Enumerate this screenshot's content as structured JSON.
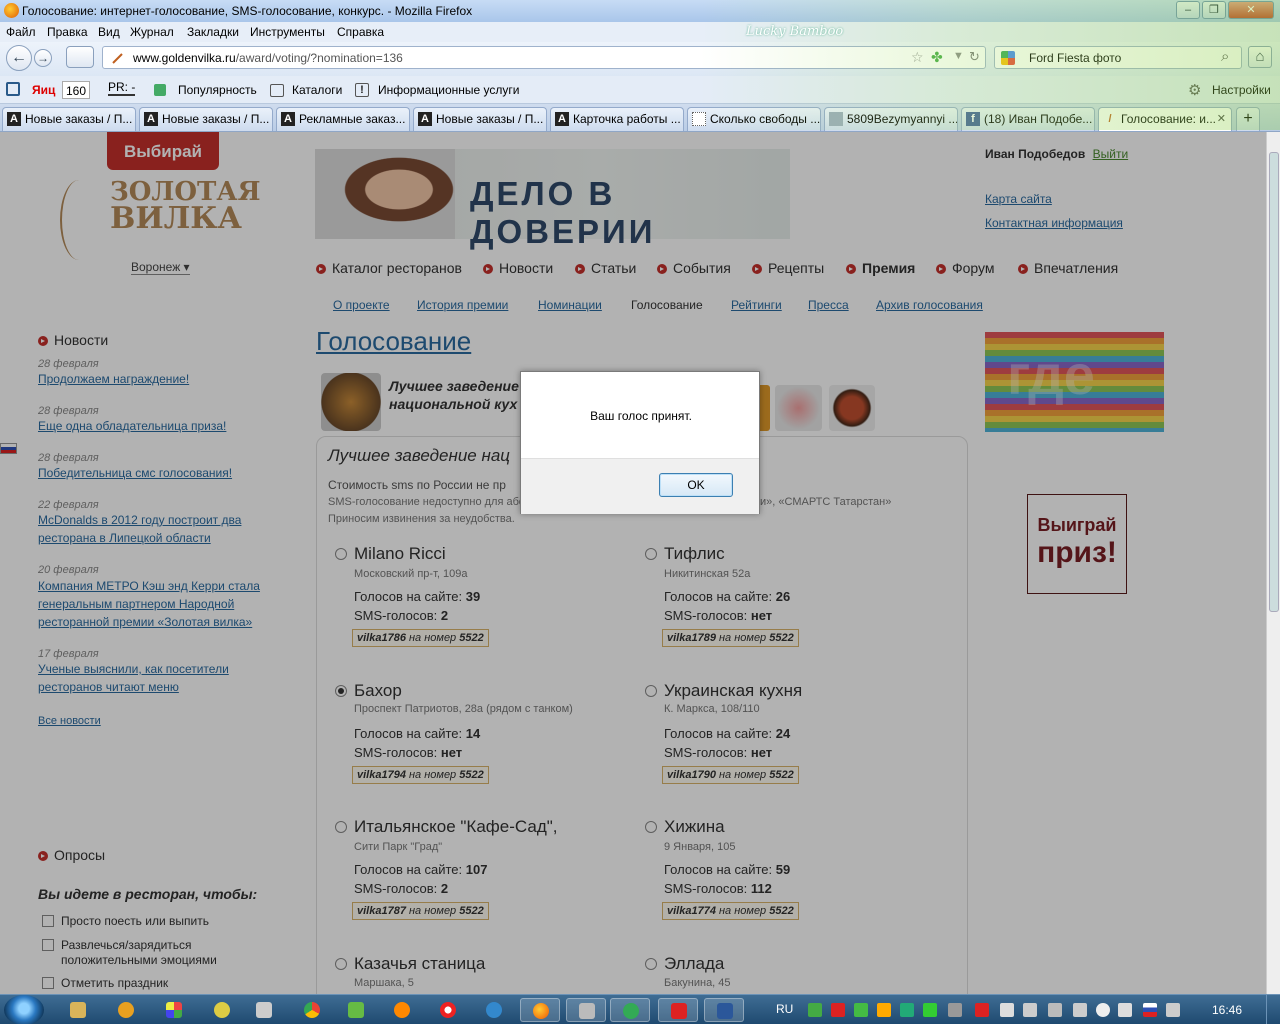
{
  "window": {
    "title": "Голосование: интернет-голосование, SMS-голосование, конкурс. - Mozilla Firefox",
    "theme_label": "Lucky Bamboo",
    "btn_min": "‒",
    "btn_max": "❐",
    "btn_close": "✕"
  },
  "menu": [
    "Файл",
    "Правка",
    "Вид",
    "Журнал",
    "Закладки",
    "Инструменты",
    "Справка"
  ],
  "nav": {
    "back_glyph": "←",
    "forward_glyph": "→",
    "url_domain": "www.goldenvilka.ru",
    "url_path": "/award/voting/?nomination=136",
    "search_text": "Ford Fiesta  фото",
    "search_glyph": "⌕",
    "home_glyph": "⌂"
  },
  "toolbar2": {
    "yandex_label": "Яиц",
    "yandex_value": "160",
    "pr_label": "PR: -",
    "popularity": "Популярность",
    "catalogs": "Каталоги",
    "services": "Информационные услуги",
    "settings": "Настройки"
  },
  "tabs": [
    {
      "label": "Новые заказы / П...",
      "icon": "A"
    },
    {
      "label": "Новые заказы / П...",
      "icon": "A"
    },
    {
      "label": "Рекламные заказ...",
      "icon": "A"
    },
    {
      "label": "Новые заказы / П...",
      "icon": "A"
    },
    {
      "label": "Карточка работы ...",
      "icon": "A"
    },
    {
      "label": "Сколько свободы ...",
      "icon": ""
    },
    {
      "label": "5809Bezymyannyi ...",
      "icon": ""
    },
    {
      "label": "(18) Иван Подобе...",
      "icon": "f"
    },
    {
      "label": "Голосование: и...",
      "icon": ""
    }
  ],
  "site": {
    "badge": "Выбирай",
    "logo_line1": "ЗОЛОТАЯ",
    "logo_line2": "ВИЛКА",
    "city": "Воронеж ▾",
    "banner_slogan": "ДЕЛО В ДОВЕРИИ",
    "user_name": "Иван Подобедов",
    "logout": "Выйти",
    "sitemap": "Карта сайта",
    "contacts": "Контактная информация",
    "main_nav": [
      "Каталог ресторанов",
      "Новости",
      "Статьи",
      "События",
      "Рецепты",
      "Премия",
      "Форум",
      "Впечатления"
    ],
    "sub_nav": [
      "О проекте",
      "История премии",
      "Номинации",
      "Голосование",
      "Рейтинги",
      "Пресса",
      "Архив голосования"
    ],
    "page_title": "Голосование",
    "prize_a": "Выиграй",
    "prize_b": "приз!",
    "rainbow_text": "где"
  },
  "news": {
    "heading": "Новости",
    "items": [
      {
        "date": "28 февраля",
        "title": "Продолжаем награждение!"
      },
      {
        "date": "28 февраля",
        "title": "Еще одна обладательница приза!"
      },
      {
        "date": "28 февраля",
        "title": "Победительница смс голосования!"
      },
      {
        "date": "22 февраля",
        "title": "McDonalds в 2012 году построит два ресторана в Липецкой области"
      },
      {
        "date": "20 февраля",
        "title": "Компания МЕТРО Кэш энд Керри стала генеральным партнером Народной ресторанной премии «Золотая вилка»"
      },
      {
        "date": "17 февраля",
        "title": "Ученые выяснили, как посетители ресторанов читают меню"
      }
    ],
    "all": "Все новости"
  },
  "nomination": {
    "title": "Лучшее заведение национальной кух",
    "subtitle": "Лучшее заведение нац",
    "sms_cost": "Стоимость sms по России не пр",
    "sms_note1": "SMS-голосование недоступно для абс",
    "sms_note1_tail": "и», «СМАРТС Татарстан»",
    "sms_note2": "Приносим извинения за неудобства."
  },
  "candidates": [
    {
      "name": "Milano Ricci",
      "addr": "Московский пр-т, 109а",
      "site_label": "Голосов на сайте:",
      "site": "39",
      "sms_label": "SMS-голосов:",
      "sms": "2",
      "code": "vilka1786",
      "code_mid": "на номер",
      "number": "5522",
      "selected": false
    },
    {
      "name": "Тифлис",
      "addr": "Никитинская 52а",
      "site_label": "Голосов на сайте:",
      "site": "26",
      "sms_label": "SMS-голосов:",
      "sms": "нет",
      "code": "vilka1789",
      "code_mid": "на номер",
      "number": "5522",
      "selected": false
    },
    {
      "name": "Бахор",
      "addr": "Проспект Патриотов, 28а (рядом с танком)",
      "site_label": "Голосов на сайте:",
      "site": "14",
      "sms_label": "SMS-голосов:",
      "sms": "нет",
      "code": "vilka1794",
      "code_mid": "на номер",
      "number": "5522",
      "selected": true
    },
    {
      "name": "Украинская кухня",
      "addr": "К. Маркса, 108/110",
      "site_label": "Голосов на сайте:",
      "site": "24",
      "sms_label": "SMS-голосов:",
      "sms": "нет",
      "code": "vilka1790",
      "code_mid": "на номер",
      "number": "5522",
      "selected": false
    },
    {
      "name": "Итальянское \"Кафе-Сад\",",
      "addr": "Сити Парк \"Град\"",
      "site_label": "Голосов на сайте:",
      "site": "107",
      "sms_label": "SMS-голосов:",
      "sms": "2",
      "code": "vilka1787",
      "code_mid": "на номер",
      "number": "5522",
      "selected": false
    },
    {
      "name": "Хижина",
      "addr": "9 Января, 105",
      "site_label": "Голосов на сайте:",
      "site": "59",
      "sms_label": "SMS-голосов:",
      "sms": "112",
      "code": "vilka1774",
      "code_mid": "на номер",
      "number": "5522",
      "selected": false
    },
    {
      "name": "Казачья станица",
      "addr": "Маршака, 5",
      "selected": false
    },
    {
      "name": "Эллада",
      "addr": "Бакунина, 45",
      "selected": false
    }
  ],
  "poll": {
    "heading": "Опросы",
    "question": "Вы идете в ресторан, чтобы:",
    "options": [
      "Просто поесть или выпить",
      "Развлечься/зарядиться положительными эмоциями",
      "Отметить праздник"
    ]
  },
  "dialog": {
    "message": "Ваш голос принят.",
    "ok": "OK"
  },
  "taskbar": {
    "lang": "RU",
    "clock": "16:46"
  }
}
